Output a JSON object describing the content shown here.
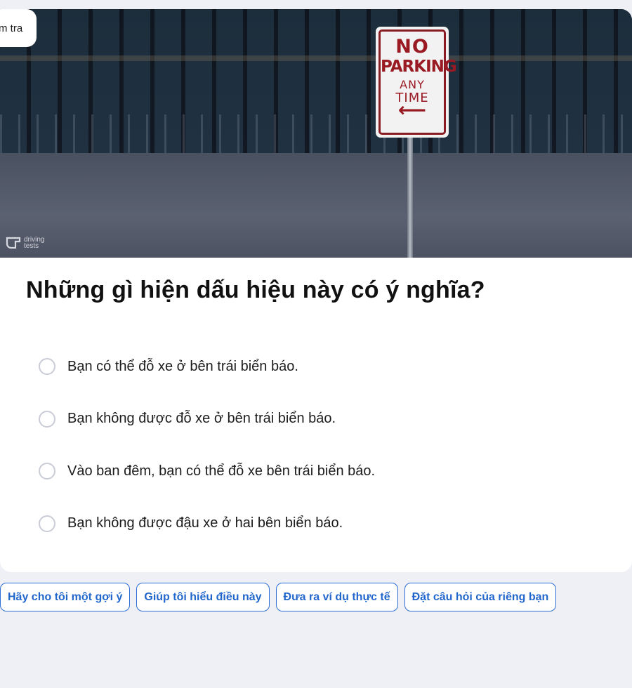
{
  "back_label": "m tra",
  "image": {
    "sign_line1": "NO",
    "sign_line2": "PARKING",
    "sign_line3": "ANY",
    "sign_line4": "TIME",
    "sign_arrow": "⟵",
    "watermark_line1": "driving",
    "watermark_line2": "tests"
  },
  "question": "Những gì hiện dấu hiệu này có ý nghĩa?",
  "options": [
    "Bạn có thể đỗ xe ở bên trái biển báo.",
    "Bạn không được đỗ xe ở bên trái biển báo.",
    "Vào ban đêm, bạn có thể đỗ xe bên trái biển báo.",
    "Bạn không được đậu xe ở hai bên biển báo."
  ],
  "suggestions": [
    "Hãy cho tôi một gợi ý",
    "Giúp tôi hiểu điều này",
    "Đưa ra ví dụ thực tế",
    "Đặt câu hỏi của riêng bạn"
  ],
  "colors": {
    "accent": "#2266cc",
    "background": "#eff0f6",
    "sign_red": "#9a1a23"
  }
}
